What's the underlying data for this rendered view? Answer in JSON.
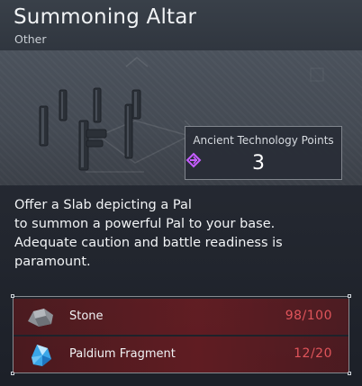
{
  "header": {
    "title": "Summoning Altar",
    "category": "Other"
  },
  "tech_points": {
    "label": "Ancient Technology Points",
    "value": "3",
    "icon": "ancient-tech-point-icon",
    "icon_color": "#c65cff"
  },
  "description": {
    "lines": [
      "Offer a Slab depicting a Pal",
      "to summon a powerful Pal to your base.",
      "Adequate caution and battle readiness is",
      "paramount."
    ]
  },
  "materials": [
    {
      "name": "Stone",
      "icon": "stone-icon",
      "count": "98/100"
    },
    {
      "name": "Paldium Fragment",
      "icon": "paldium-fragment-icon",
      "count": "12/20"
    }
  ],
  "colors": {
    "insufficient": "#e0545a",
    "material_row": "#8e1a1e"
  }
}
